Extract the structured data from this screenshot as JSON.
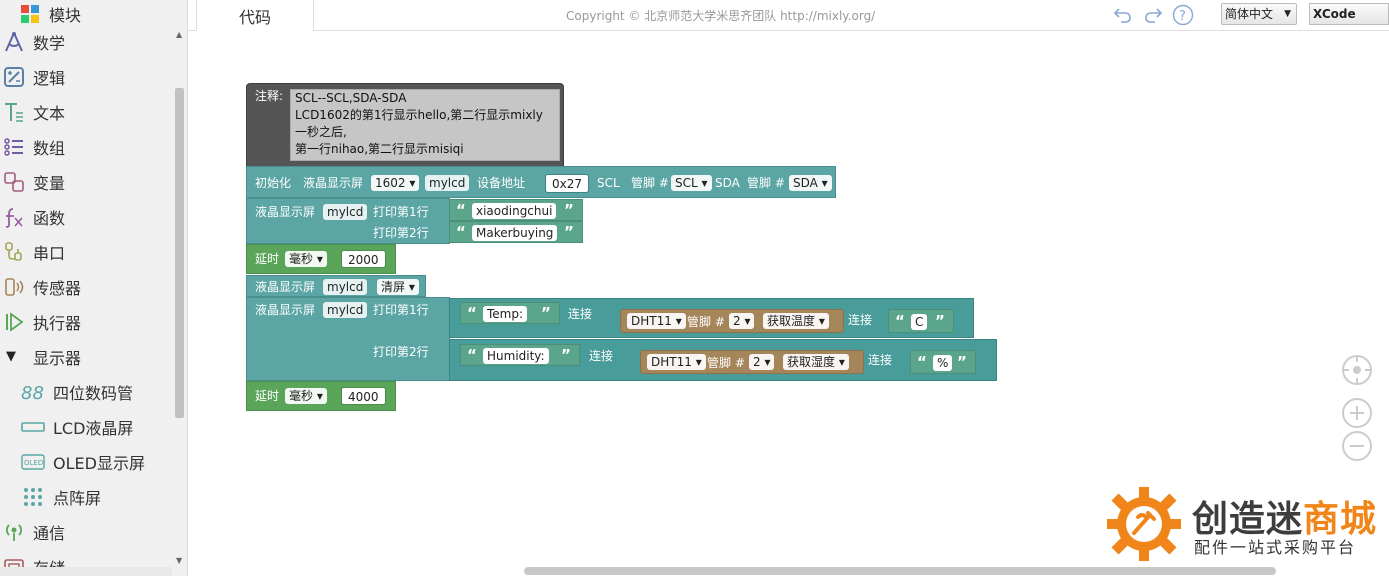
{
  "sidebar": {
    "items": [
      {
        "label": "模块",
        "icon": "modules-puzzle-icon"
      },
      {
        "label": "数学",
        "icon": "math-compass-icon"
      },
      {
        "label": "逻辑",
        "icon": "logic-icon"
      },
      {
        "label": "文本",
        "icon": "text-icon"
      },
      {
        "label": "数组",
        "icon": "array-list-icon"
      },
      {
        "label": "变量",
        "icon": "variable-icon"
      },
      {
        "label": "函数",
        "icon": "function-fx-icon"
      },
      {
        "label": "串口",
        "icon": "serial-port-icon"
      },
      {
        "label": "传感器",
        "icon": "sensor-icon"
      },
      {
        "label": "执行器",
        "icon": "actuator-play-icon"
      },
      {
        "label": "显示器",
        "icon": "expanded-arrow-icon"
      },
      {
        "label": "四位数码管",
        "icon": "seven-segment-icon"
      },
      {
        "label": "LCD液晶屏",
        "icon": "lcd-icon"
      },
      {
        "label": "OLED显示屏",
        "icon": "oled-icon"
      },
      {
        "label": "点阵屏",
        "icon": "dot-matrix-icon"
      },
      {
        "label": "通信",
        "icon": "communication-icon"
      },
      {
        "label": "存储",
        "icon": "storage-icon"
      }
    ]
  },
  "header": {
    "tab_code": "代码",
    "copyright": "Copyright © 北京师范大学米思齐团队 http://mixly.org/",
    "language": "简体中文",
    "ide": "XCode",
    "help": "?"
  },
  "blocks": {
    "comment": {
      "label": "注释:",
      "text": "SCL--SCL,SDA-SDA\nLCD1602的第1行显示hello,第二行显示mixly\n一秒之后,\n第一行nihao,第二行显示misiqi"
    },
    "init": {
      "label": "初始化",
      "lcd": "液晶显示屏",
      "model": "1602",
      "name": "mylcd",
      "addr_label": "设备地址",
      "addr": "0x27",
      "scl_label": "SCL",
      "pin_label": "管脚 #",
      "scl_pin": "SCL",
      "sda_label": "SDA",
      "pin_label2": "管脚 #",
      "sda_pin": "SDA"
    },
    "print1": {
      "lcd": "液晶显示屏",
      "name": "mylcd",
      "row1": "打印第1行",
      "text1": "xiaodingchui",
      "row2": "打印第2行",
      "text2": "Makerbuying"
    },
    "delay1": {
      "label": "延时",
      "unit": "毫秒",
      "value": "2000"
    },
    "clear": {
      "lcd": "液晶显示屏",
      "name": "mylcd",
      "action": "清屏"
    },
    "print2": {
      "lcd": "液晶显示屏",
      "name": "mylcd",
      "row1": "打印第1行",
      "row2": "打印第2行",
      "temp_text": "Temp:",
      "join": "连接",
      "dht": "DHT11",
      "pin_label": "管脚 #",
      "pin": "2",
      "get_temp": "获取温度",
      "join2": "连接",
      "unit_c": "C",
      "hum_text": "Humidity:",
      "join3": "连接",
      "dht2": "DHT11",
      "pin_label2": "管脚 #",
      "pin2": "2",
      "get_hum": "获取湿度",
      "join4": "连接",
      "unit_pct": "%"
    },
    "delay2": {
      "label": "延时",
      "unit": "毫秒",
      "value": "4000"
    }
  },
  "brand": {
    "name_a": "创造迷",
    "name_b": "商城",
    "slogan": "配件一站式采购平台"
  },
  "colors": {
    "lcd_block": "#5ba5a5",
    "time_block": "#5ba55b",
    "sensor_block": "#a5865b",
    "comment_block": "#555555",
    "brand_orange": "#f08519"
  }
}
